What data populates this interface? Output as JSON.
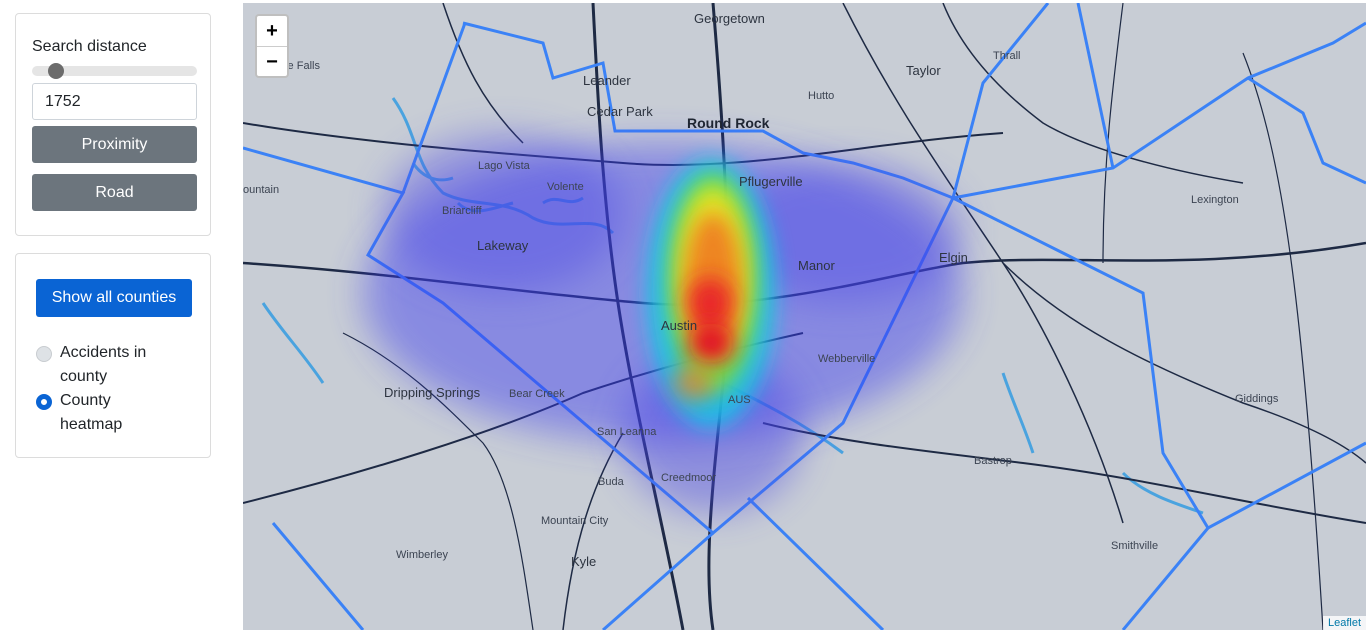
{
  "sidebar": {
    "search_label": "Search distance",
    "slider_value_fraction": 0.11,
    "distance_value": "1752",
    "proximity_label": "Proximity",
    "road_label": "Road",
    "show_all_label": "Show all counties",
    "radio_options": [
      {
        "label": "Accidents in county",
        "selected": false
      },
      {
        "label": "County heatmap",
        "selected": true
      }
    ]
  },
  "map": {
    "zoom_in": "+",
    "zoom_out": "−",
    "attribution": "Leaflet",
    "places": {
      "georgetown": "Georgetown",
      "marble_falls": "ble Falls",
      "leander": "Leander",
      "taylor": "Taylor",
      "thrall": "Thrall",
      "hutto": "Hutto",
      "cedar_park": "Cedar Park",
      "round_rock": "Round Rock",
      "lago_vista": "Lago Vista",
      "pflugerville": "Pflugerville",
      "volente": "Volente",
      "briarcliff": "Briarcliff",
      "fountain": "ountain",
      "lexington": "Lexington",
      "lakeway": "Lakeway",
      "manor": "Manor",
      "elgin": "Elgin",
      "austin": "Austin",
      "webberville": "Webberville",
      "dripping_springs": "Dripping Springs",
      "bear_creek": "Bear Creek",
      "aus": "AUS",
      "giddings": "Giddings",
      "san_leanna": "San Leanna",
      "bastrop": "Bastrop",
      "creedmoor": "Creedmoor",
      "buda": "Buda",
      "mountain_city": "Mountain City",
      "wimberley": "Wimberley",
      "smithville": "Smithville",
      "kyle": "Kyle"
    },
    "colors": {
      "county_border": "#3b82f6",
      "water": "#4aa3df",
      "road": "#1e2a44"
    }
  }
}
